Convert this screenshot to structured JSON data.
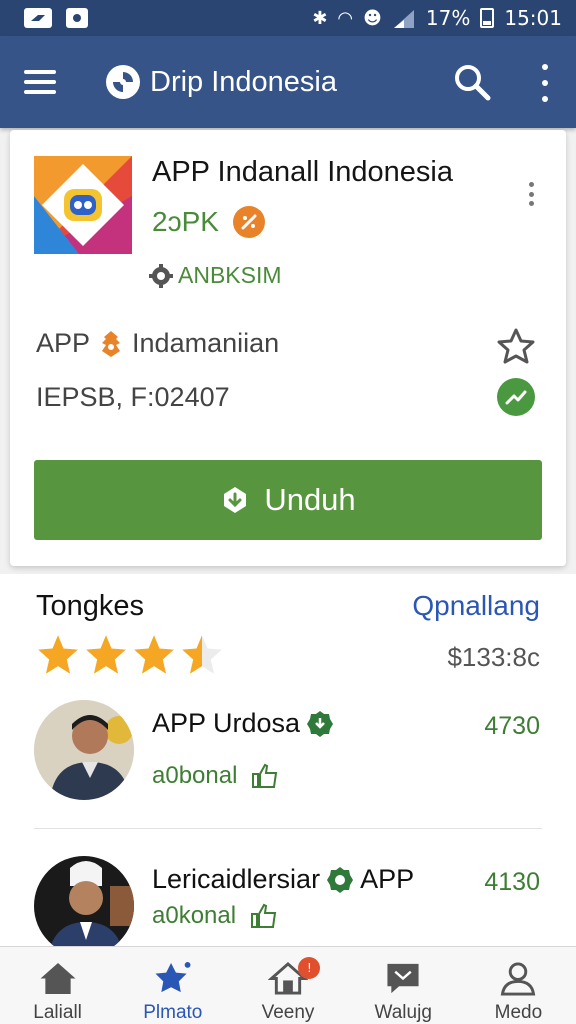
{
  "status_bar": {
    "battery": "17%",
    "time": "15:01"
  },
  "app_bar": {
    "title": "Drip Indonesia",
    "icons": [
      "menu-icon",
      "app-logo-icon",
      "search-icon",
      "more-vert-icon"
    ]
  },
  "app_card": {
    "name": "APP Indanall Indonesia",
    "size": "2ɔPK",
    "developer": "ANBKSIM",
    "category": "APP",
    "category_tail": "Indamaniian",
    "version": "IEPSB, F:02407",
    "download_label": "Unduh",
    "colors": {
      "accent_green": "#57953f",
      "app_bar": "#365487"
    }
  },
  "reviews": {
    "title": "Tongkes",
    "link": "Qpnallang",
    "rating": 3.5,
    "rating_max": 5,
    "price": "$133:8c",
    "items": [
      {
        "name": "APP Urdosa",
        "count": "4730",
        "sub": "a0bonal"
      },
      {
        "name": "Lericaidlersiar",
        "badge_text": "APP",
        "count": "4130",
        "sub": "a0konal"
      }
    ]
  },
  "bottom_nav": {
    "items": [
      {
        "label": "Laliall",
        "icon": "home-icon"
      },
      {
        "label": "Plmato",
        "icon": "star-badge-icon",
        "active": true
      },
      {
        "label": "Veeny",
        "icon": "house-outline-icon",
        "badge": "!"
      },
      {
        "label": "Walujg",
        "icon": "message-icon"
      },
      {
        "label": "Medo",
        "icon": "person-icon"
      }
    ]
  }
}
